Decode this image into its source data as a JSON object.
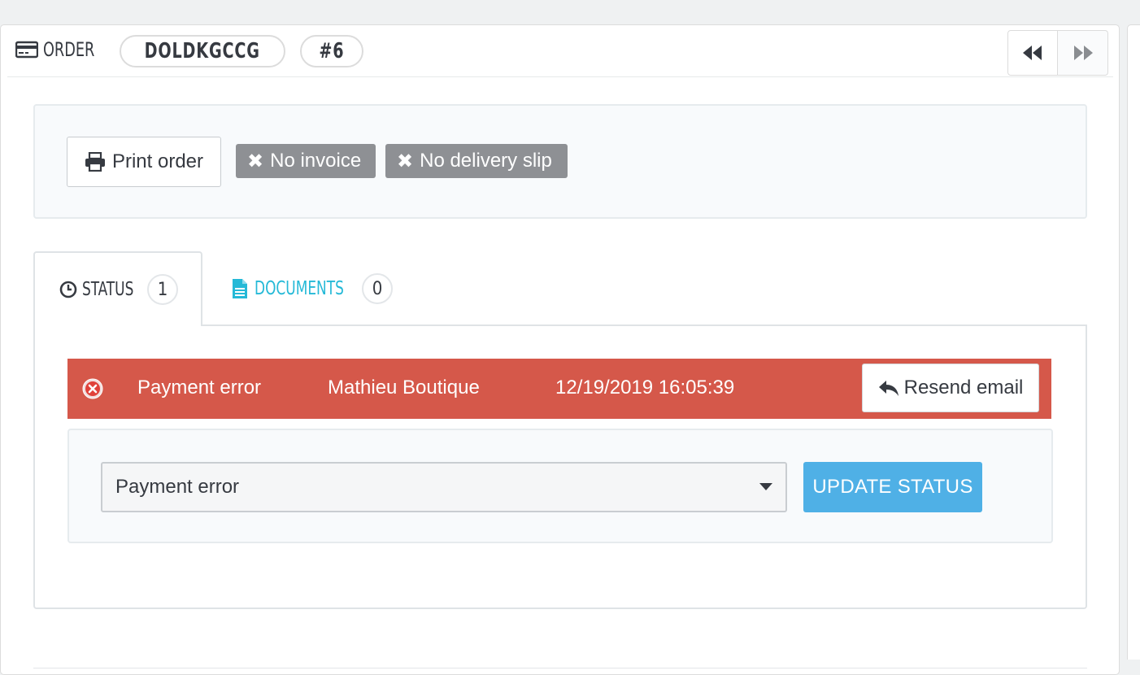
{
  "header": {
    "order_label": "ORDER",
    "reference": "DOLDKGCCG",
    "order_number": "#6",
    "prev_icon": "fast-backward-icon",
    "next_icon": "fast-forward-icon"
  },
  "documents_bar": {
    "print_label": "Print order",
    "no_invoice_label": "No invoice",
    "no_delivery_label": "No delivery slip"
  },
  "tabs": [
    {
      "label": "STATUS",
      "count": "1",
      "icon": "clock-icon",
      "active": true
    },
    {
      "label": "DOCUMENTS",
      "count": "0",
      "icon": "document-icon",
      "active": false
    }
  ],
  "status_history": {
    "status": "Payment error",
    "employee": "Mathieu Boutique",
    "date": "12/19/2019 16:05:39",
    "resend_label": "Resend email",
    "row_color": "#d5584a"
  },
  "update": {
    "selected_status": "Payment error",
    "button_label": "UPDATE STATUS",
    "button_color": "#4fb0e6"
  }
}
